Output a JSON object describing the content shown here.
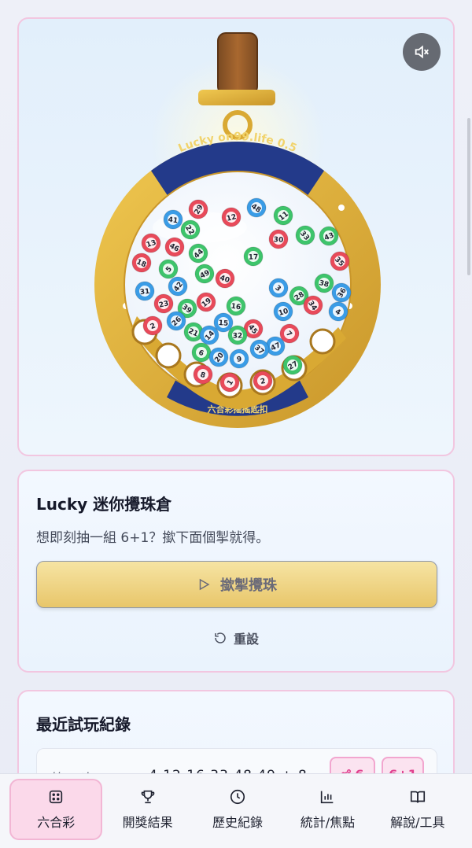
{
  "machine": {
    "ring_title": "Lucky on99.life 0.5",
    "ring_subtitle": "六合彩搖搖匙扣",
    "mute_icon": "speaker-muted-icon",
    "balls_in_drum": [
      {
        "n": "29",
        "c": "red"
      },
      {
        "n": "12",
        "c": "red"
      },
      {
        "n": "48",
        "c": "blue"
      },
      {
        "n": "11",
        "c": "green"
      },
      {
        "n": "41",
        "c": "blue"
      },
      {
        "n": "22",
        "c": "green"
      },
      {
        "n": "13",
        "c": "red"
      },
      {
        "n": "46",
        "c": "red"
      },
      {
        "n": "44",
        "c": "green"
      },
      {
        "n": "30",
        "c": "red"
      },
      {
        "n": "33",
        "c": "green"
      },
      {
        "n": "43",
        "c": "green"
      },
      {
        "n": "18",
        "c": "red"
      },
      {
        "n": "5",
        "c": "green"
      },
      {
        "n": "17",
        "c": "green"
      },
      {
        "n": "35",
        "c": "red"
      },
      {
        "n": "49",
        "c": "green"
      },
      {
        "n": "40",
        "c": "red"
      },
      {
        "n": "42",
        "c": "blue"
      },
      {
        "n": "31",
        "c": "blue"
      },
      {
        "n": "3",
        "c": "blue"
      },
      {
        "n": "28",
        "c": "green"
      },
      {
        "n": "38",
        "c": "green"
      },
      {
        "n": "36",
        "c": "blue"
      },
      {
        "n": "23",
        "c": "red"
      },
      {
        "n": "39",
        "c": "green"
      },
      {
        "n": "19",
        "c": "red"
      },
      {
        "n": "16",
        "c": "green"
      },
      {
        "n": "34",
        "c": "red"
      },
      {
        "n": "10",
        "c": "blue"
      },
      {
        "n": "4",
        "c": "blue"
      },
      {
        "n": "26",
        "c": "blue"
      },
      {
        "n": "15",
        "c": "blue"
      },
      {
        "n": "45",
        "c": "red"
      },
      {
        "n": "2",
        "c": "red"
      },
      {
        "n": "21",
        "c": "green"
      },
      {
        "n": "14",
        "c": "blue"
      },
      {
        "n": "32",
        "c": "green"
      },
      {
        "n": "7",
        "c": "red"
      },
      {
        "n": "47",
        "c": "blue"
      },
      {
        "n": "6",
        "c": "green"
      },
      {
        "n": "20",
        "c": "blue"
      },
      {
        "n": "9",
        "c": "blue"
      },
      {
        "n": "37",
        "c": "blue"
      },
      {
        "n": "27",
        "c": "green"
      },
      {
        "n": "8",
        "c": "red"
      },
      {
        "n": "1",
        "c": "red"
      },
      {
        "n": "2",
        "c": "red"
      }
    ],
    "colors": {
      "red": "#e84a5a",
      "blue": "#3a9ce6",
      "green": "#3ec46b",
      "gold": "#e3b33a",
      "navy": "#233a8a"
    }
  },
  "draw": {
    "title": "Lucky 迷你攪珠倉",
    "description": "想即刻抽一組 6+1？撳下面個掣就得。",
    "draw_button": "撳掣攪珠",
    "reset_button": "重設"
  },
  "history": {
    "title": "最近試玩紀錄",
    "rows": [
      {
        "label": "第 1 次",
        "numbers": "4 12 16 33 48 49 + 8",
        "share_chip": "6",
        "count_chip": "6+1"
      }
    ]
  },
  "nav": {
    "items": [
      {
        "label": "六合彩",
        "icon": "dice-icon",
        "active": true
      },
      {
        "label": "開獎結果",
        "icon": "trophy-icon",
        "active": false
      },
      {
        "label": "歷史紀錄",
        "icon": "clock-icon",
        "active": false
      },
      {
        "label": "統計/焦點",
        "icon": "bar-chart-icon",
        "active": false
      },
      {
        "label": "解說/工具",
        "icon": "book-icon",
        "active": false
      }
    ]
  }
}
